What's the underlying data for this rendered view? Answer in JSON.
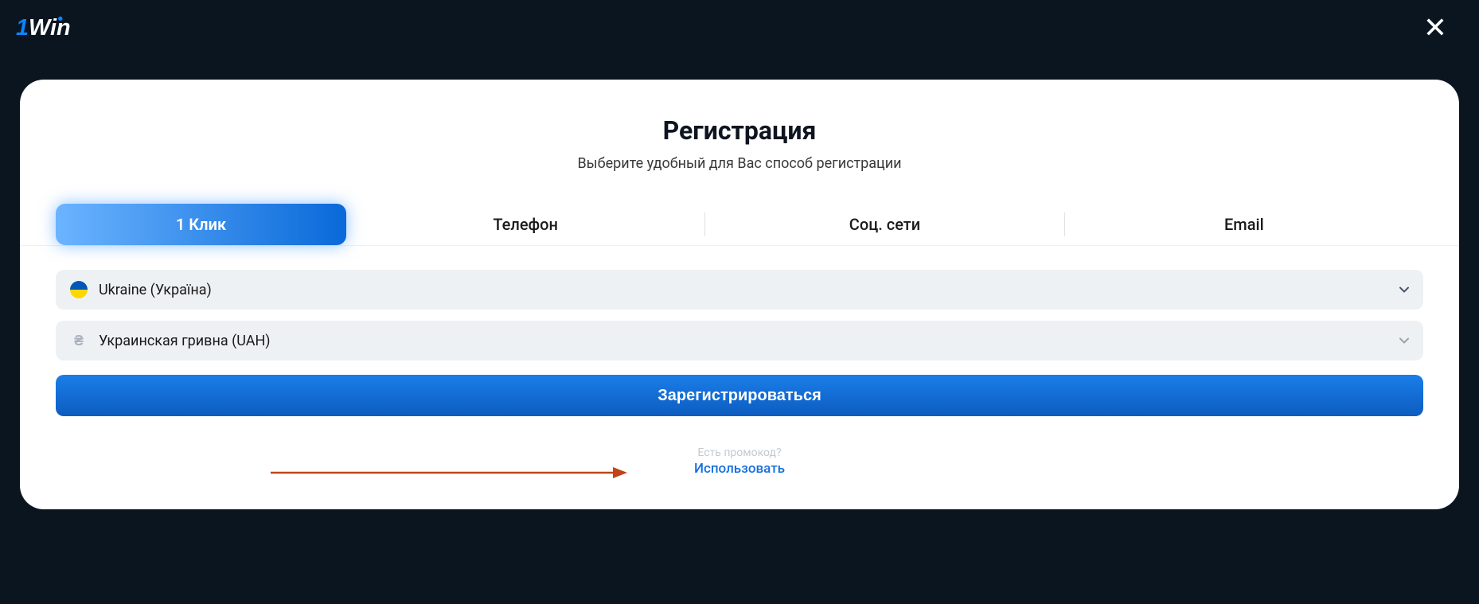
{
  "brand": "1win",
  "modal": {
    "title": "Регистрация",
    "subtitle": "Выберите удобный для Вас способ регистрации",
    "tabs": [
      {
        "label": "1 Клик",
        "active": true
      },
      {
        "label": "Телефон",
        "active": false
      },
      {
        "label": "Соц. сети",
        "active": false
      },
      {
        "label": "Email",
        "active": false
      }
    ],
    "country": {
      "label": "Ukraine (Україна)",
      "code": "UA"
    },
    "currency": {
      "label": "Украинская гривна (UAH)",
      "symbol": "₴"
    },
    "submit_label": "Зарегистрироваться",
    "promo_question": "Есть промокод?",
    "promo_link": "Использовать"
  },
  "colors": {
    "bg_dark": "#0a1520",
    "accent_blue": "#0969d9",
    "accent_blue_light": "#6bb4ff",
    "annotation_arrow": "#c0431a"
  }
}
